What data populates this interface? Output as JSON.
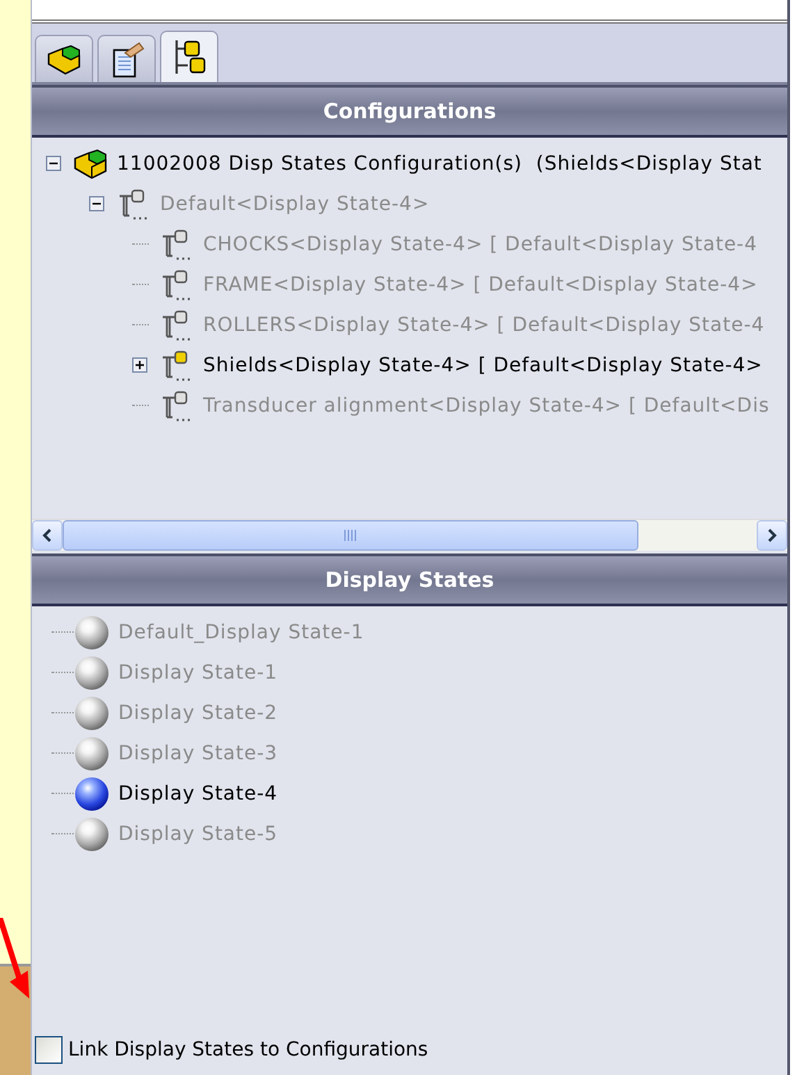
{
  "tabs": [
    {
      "kind": "feature",
      "selected": false
    },
    {
      "kind": "property",
      "selected": false
    },
    {
      "kind": "configuration",
      "selected": true
    }
  ],
  "configurations": {
    "title": "Configurations",
    "tree": [
      {
        "label": "11002008 Disp States Configuration(s)  (Shields<Display Stat",
        "kind": "assembly",
        "active": true,
        "expanded": true,
        "children": [
          {
            "label": "Default<Display State-4>",
            "kind": "config",
            "active": false,
            "expanded": true,
            "children": [
              {
                "label": "CHOCKS<Display State-4> [ Default<Display State-4",
                "kind": "config",
                "active": false
              },
              {
                "label": "FRAME<Display State-4> [ Default<Display State-4>",
                "kind": "config",
                "active": false
              },
              {
                "label": "ROLLERS<Display State-4> [ Default<Display State-4",
                "kind": "config",
                "active": false
              },
              {
                "label": "Shields<Display State-4> [ Default<Display State-4>",
                "kind": "config",
                "active": true,
                "expanded": false
              },
              {
                "label": "Transducer alignment<Display State-4> [ Default<Dis",
                "kind": "config",
                "active": false
              }
            ]
          }
        ]
      }
    ]
  },
  "display_states": {
    "title": "Display States",
    "items": [
      {
        "label": "Default_Display State-1",
        "selected": false
      },
      {
        "label": "Display State-1",
        "selected": false
      },
      {
        "label": "Display State-2",
        "selected": false
      },
      {
        "label": "Display State-3",
        "selected": false
      },
      {
        "label": "Display State-4",
        "selected": true
      },
      {
        "label": "Display State-5",
        "selected": false
      }
    ]
  },
  "link_option": {
    "label": "Link Display States to Configurations",
    "checked": false
  }
}
